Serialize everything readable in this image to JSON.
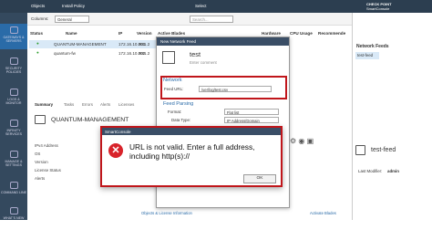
{
  "topbar": {
    "objects_label": "Objects",
    "install_label": "Install Policy",
    "select_label": "Select",
    "brand": "CHECK POINT",
    "brand_sub": "SmartConsole"
  },
  "leftnav": [
    "GATEWAYS & SERVERS",
    "SECURITY POLICIES",
    "LOGS & MONITOR",
    "INFINITY SERVICES",
    "MANAGE & SETTINGS",
    "COMMAND LINE",
    "WHAT'S NEW"
  ],
  "toolbar": {
    "columns_label": "Columns:",
    "columns_value": "General",
    "search_placeholder": "Search..."
  },
  "table": {
    "headers": [
      "Status",
      "Name",
      "IP",
      "Version",
      "Active Blades",
      "Hardware",
      "CPU Usage",
      "Recommende"
    ],
    "rows": [
      {
        "name": "QUANTUM-MANAGEMENT",
        "ip": "172.16.10.201",
        "version": "R81.2"
      },
      {
        "name": "quantum-fw",
        "ip": "172.16.10.202",
        "version": "R81.2"
      }
    ]
  },
  "summary_tabs": [
    "Summary",
    "Tasks",
    "Errors",
    "Alerts",
    "Licenses"
  ],
  "summary": {
    "title": "QUANTUM-MANAGEMENT",
    "rows": [
      {
        "k": "IPv4 Address",
        "v": "172."
      },
      {
        "k": "OS",
        "v": "Gaia"
      },
      {
        "k": "Version",
        "v": "R81"
      },
      {
        "k": "License Status",
        "v": ""
      },
      {
        "k": "Alerts",
        "v": ""
      }
    ],
    "footer_left": "Objects & License Information",
    "footer_right": "Activate Blades"
  },
  "network_feed_dialog": {
    "title": "New Network Feed",
    "name": "test",
    "comment_placeholder": "Enter comment",
    "section_network": "Network",
    "feed_url_label": "Feed URL:",
    "feed_url_value": "/ver/log/test.csv",
    "section_feed": "Feed Parsing",
    "format_label": "Format:",
    "format_value": "Flat list",
    "data_type_label": "Data Type:",
    "data_type_value": "IP Address/Domain"
  },
  "error_dialog": {
    "title": "SmartConsole",
    "message": "URL is not valid. Enter a full address, including http(s)://",
    "ok_label": "OK"
  },
  "right_pane": {
    "header": "Network Feeds",
    "item": "test-feed",
    "details_title": "test-feed",
    "last_modifier_label": "Last Modifier:",
    "last_modifier_value": "admin"
  },
  "colors": {
    "accent": "#2a6ba8",
    "error_red": "#c0161b",
    "nav_bg": "#34495e"
  }
}
